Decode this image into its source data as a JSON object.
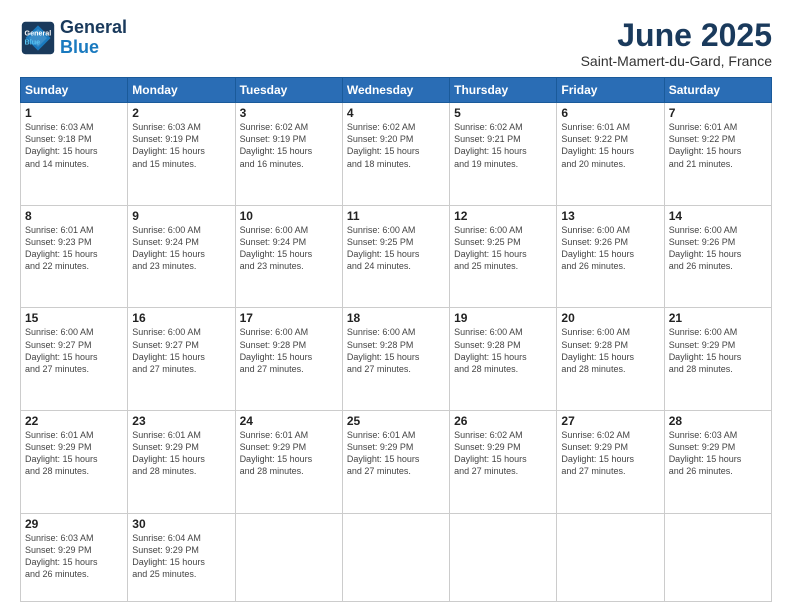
{
  "header": {
    "logo_line1": "General",
    "logo_line2": "Blue",
    "month": "June 2025",
    "location": "Saint-Mamert-du-Gard, France"
  },
  "weekdays": [
    "Sunday",
    "Monday",
    "Tuesday",
    "Wednesday",
    "Thursday",
    "Friday",
    "Saturday"
  ],
  "weeks": [
    [
      {
        "day": "1",
        "info": "Sunrise: 6:03 AM\nSunset: 9:18 PM\nDaylight: 15 hours\nand 14 minutes."
      },
      {
        "day": "2",
        "info": "Sunrise: 6:03 AM\nSunset: 9:19 PM\nDaylight: 15 hours\nand 15 minutes."
      },
      {
        "day": "3",
        "info": "Sunrise: 6:02 AM\nSunset: 9:19 PM\nDaylight: 15 hours\nand 16 minutes."
      },
      {
        "day": "4",
        "info": "Sunrise: 6:02 AM\nSunset: 9:20 PM\nDaylight: 15 hours\nand 18 minutes."
      },
      {
        "day": "5",
        "info": "Sunrise: 6:02 AM\nSunset: 9:21 PM\nDaylight: 15 hours\nand 19 minutes."
      },
      {
        "day": "6",
        "info": "Sunrise: 6:01 AM\nSunset: 9:22 PM\nDaylight: 15 hours\nand 20 minutes."
      },
      {
        "day": "7",
        "info": "Sunrise: 6:01 AM\nSunset: 9:22 PM\nDaylight: 15 hours\nand 21 minutes."
      }
    ],
    [
      {
        "day": "8",
        "info": "Sunrise: 6:01 AM\nSunset: 9:23 PM\nDaylight: 15 hours\nand 22 minutes."
      },
      {
        "day": "9",
        "info": "Sunrise: 6:00 AM\nSunset: 9:24 PM\nDaylight: 15 hours\nand 23 minutes."
      },
      {
        "day": "10",
        "info": "Sunrise: 6:00 AM\nSunset: 9:24 PM\nDaylight: 15 hours\nand 23 minutes."
      },
      {
        "day": "11",
        "info": "Sunrise: 6:00 AM\nSunset: 9:25 PM\nDaylight: 15 hours\nand 24 minutes."
      },
      {
        "day": "12",
        "info": "Sunrise: 6:00 AM\nSunset: 9:25 PM\nDaylight: 15 hours\nand 25 minutes."
      },
      {
        "day": "13",
        "info": "Sunrise: 6:00 AM\nSunset: 9:26 PM\nDaylight: 15 hours\nand 26 minutes."
      },
      {
        "day": "14",
        "info": "Sunrise: 6:00 AM\nSunset: 9:26 PM\nDaylight: 15 hours\nand 26 minutes."
      }
    ],
    [
      {
        "day": "15",
        "info": "Sunrise: 6:00 AM\nSunset: 9:27 PM\nDaylight: 15 hours\nand 27 minutes."
      },
      {
        "day": "16",
        "info": "Sunrise: 6:00 AM\nSunset: 9:27 PM\nDaylight: 15 hours\nand 27 minutes."
      },
      {
        "day": "17",
        "info": "Sunrise: 6:00 AM\nSunset: 9:28 PM\nDaylight: 15 hours\nand 27 minutes."
      },
      {
        "day": "18",
        "info": "Sunrise: 6:00 AM\nSunset: 9:28 PM\nDaylight: 15 hours\nand 27 minutes."
      },
      {
        "day": "19",
        "info": "Sunrise: 6:00 AM\nSunset: 9:28 PM\nDaylight: 15 hours\nand 28 minutes."
      },
      {
        "day": "20",
        "info": "Sunrise: 6:00 AM\nSunset: 9:28 PM\nDaylight: 15 hours\nand 28 minutes."
      },
      {
        "day": "21",
        "info": "Sunrise: 6:00 AM\nSunset: 9:29 PM\nDaylight: 15 hours\nand 28 minutes."
      }
    ],
    [
      {
        "day": "22",
        "info": "Sunrise: 6:01 AM\nSunset: 9:29 PM\nDaylight: 15 hours\nand 28 minutes."
      },
      {
        "day": "23",
        "info": "Sunrise: 6:01 AM\nSunset: 9:29 PM\nDaylight: 15 hours\nand 28 minutes."
      },
      {
        "day": "24",
        "info": "Sunrise: 6:01 AM\nSunset: 9:29 PM\nDaylight: 15 hours\nand 28 minutes."
      },
      {
        "day": "25",
        "info": "Sunrise: 6:01 AM\nSunset: 9:29 PM\nDaylight: 15 hours\nand 27 minutes."
      },
      {
        "day": "26",
        "info": "Sunrise: 6:02 AM\nSunset: 9:29 PM\nDaylight: 15 hours\nand 27 minutes."
      },
      {
        "day": "27",
        "info": "Sunrise: 6:02 AM\nSunset: 9:29 PM\nDaylight: 15 hours\nand 27 minutes."
      },
      {
        "day": "28",
        "info": "Sunrise: 6:03 AM\nSunset: 9:29 PM\nDaylight: 15 hours\nand 26 minutes."
      }
    ],
    [
      {
        "day": "29",
        "info": "Sunrise: 6:03 AM\nSunset: 9:29 PM\nDaylight: 15 hours\nand 26 minutes."
      },
      {
        "day": "30",
        "info": "Sunrise: 6:04 AM\nSunset: 9:29 PM\nDaylight: 15 hours\nand 25 minutes."
      },
      {
        "day": "",
        "info": ""
      },
      {
        "day": "",
        "info": ""
      },
      {
        "day": "",
        "info": ""
      },
      {
        "day": "",
        "info": ""
      },
      {
        "day": "",
        "info": ""
      }
    ]
  ]
}
